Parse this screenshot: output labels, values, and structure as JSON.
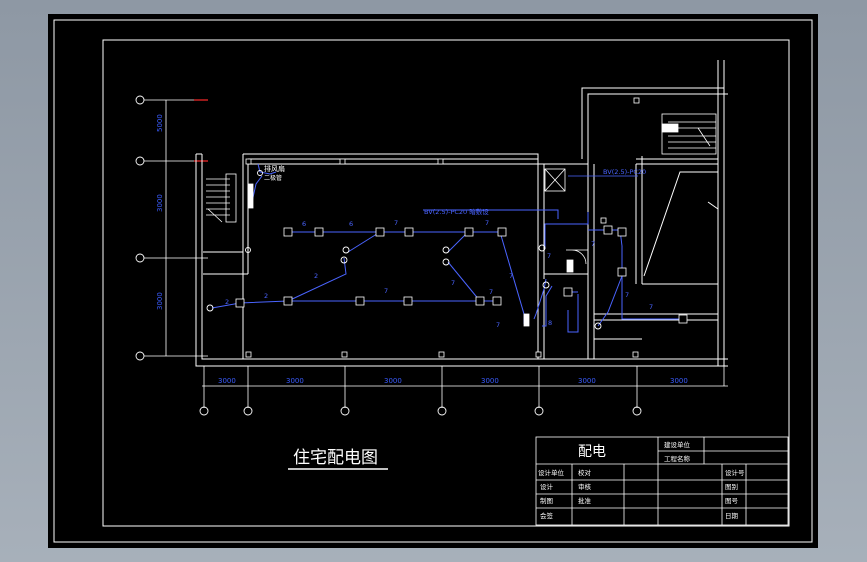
{
  "colors": {
    "background": "#000000",
    "frame": "#ffffff",
    "dimension": "#3a5cff",
    "circuit": "#4a64ff",
    "axis_red": "#ff2a2a",
    "screen_gray": "#9aa3ad"
  },
  "drawing": {
    "title": "住宅配电图",
    "room_label_top": "排风扇",
    "room_label_bottom": "二极管",
    "cable_note": "BV(2.5)-PC20",
    "bus_note": "BV(2.5)-PC20 暗敷设"
  },
  "dimensions": {
    "vertical": [
      "5000",
      "3000",
      "3000"
    ],
    "horizontal": [
      "3000",
      "3000",
      "3000",
      "3000",
      "3000",
      "3000"
    ]
  },
  "circuit_labels": [
    "6",
    "6",
    "7",
    "7",
    "2",
    "2",
    "2",
    "7",
    "7",
    "7",
    "7",
    "7",
    "7",
    "8",
    "7",
    "7",
    "7"
  ],
  "title_block": {
    "main_title": "配电",
    "cells": {
      "unit_label": "建设单位",
      "project_label": "工程名称",
      "design_unit": "设计单位",
      "check": "校对",
      "design": "设计",
      "review": "审核",
      "draw": "制图",
      "approve": "批准",
      "count": "会签",
      "drawing_no": "设计号",
      "sheet_no": "图别",
      "scale": "图号",
      "date": "日期"
    }
  }
}
